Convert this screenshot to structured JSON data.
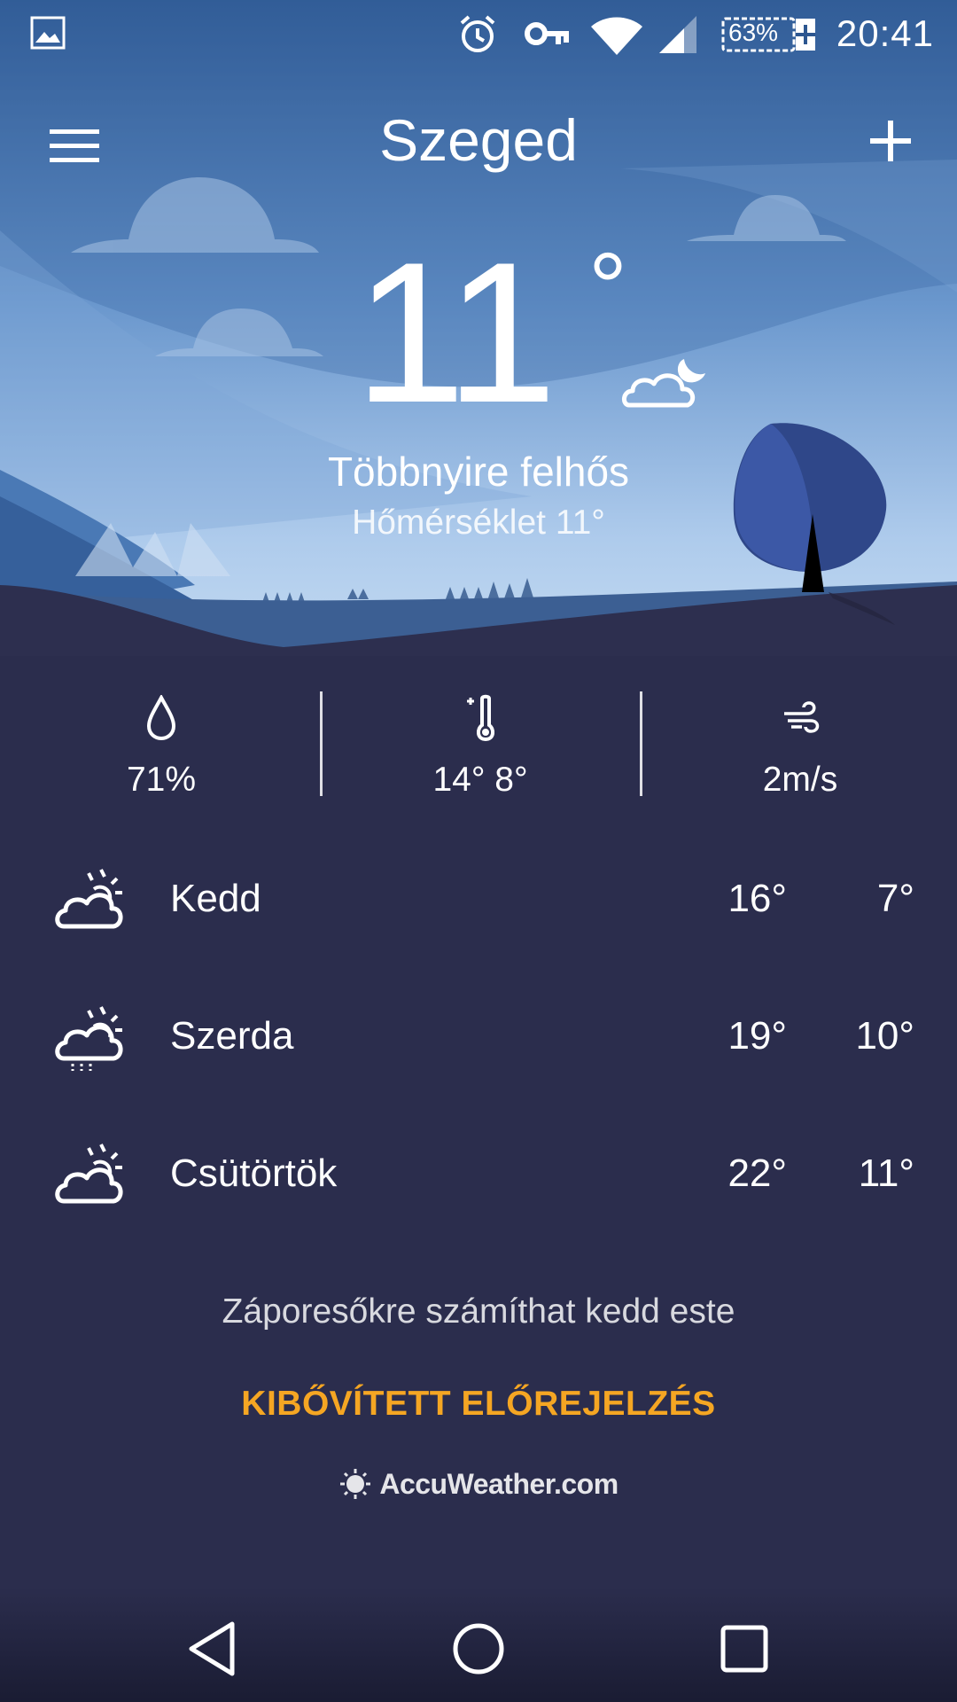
{
  "status_bar": {
    "time": "20:41",
    "battery_percent": "63%",
    "icons": [
      "image-notification-icon",
      "alarm-icon",
      "vpn-key-icon",
      "wifi-icon",
      "cell-signal-icon",
      "battery-charging-icon"
    ]
  },
  "app_bar": {
    "city": "Szeged",
    "menu_icon": "hamburger-menu-icon",
    "add_icon": "plus-icon"
  },
  "current": {
    "temperature": "11",
    "degree_symbol": "°",
    "condition": "Többnyire felhős",
    "feels_like": "Hőmérséklet 11°",
    "condition_icon": "cloud-moon-icon"
  },
  "stats": {
    "humidity": "71%",
    "high_low": "14°  8°",
    "wind": "2m/s"
  },
  "forecast": [
    {
      "day": "Kedd",
      "high": "16°",
      "low": "7°",
      "icon": "partly-cloudy-icon"
    },
    {
      "day": "Szerda",
      "high": "19°",
      "low": "10°",
      "icon": "partly-cloudy-rain-icon"
    },
    {
      "day": "Csütörtök",
      "high": "22°",
      "low": "11°",
      "icon": "partly-cloudy-icon"
    }
  ],
  "summary": "Záporesőkre számíthat kedd este",
  "extended_forecast_label": "KIBŐVÍTETT ELŐREJELZÉS",
  "brand": "AccuWeather.com",
  "colors": {
    "background": "#2b2d4d",
    "accent": "#f5a623",
    "sky_top": "#2f5b93",
    "sky_bottom": "#bfd7f0"
  }
}
